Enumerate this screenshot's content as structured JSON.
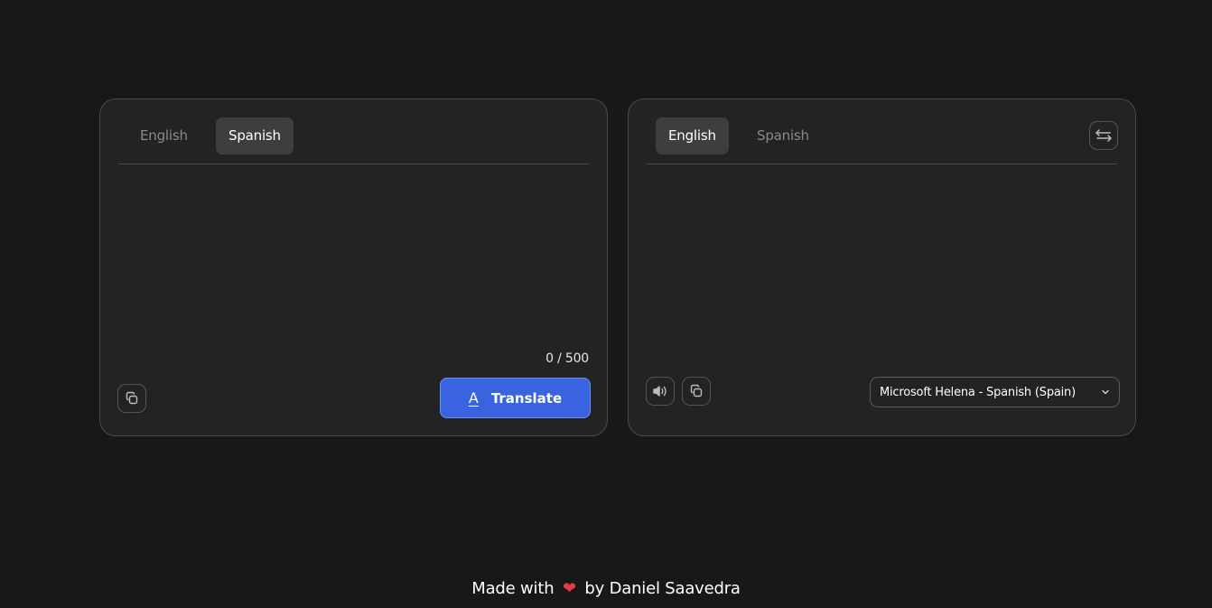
{
  "source_panel": {
    "tabs": [
      {
        "label": "English",
        "active": false
      },
      {
        "label": "Spanish",
        "active": true
      }
    ],
    "input_value": "",
    "char_counter": "0 / 500",
    "copy_icon": "copy-icon",
    "translate_button": {
      "label": "Translate",
      "icon": "A",
      "color": "#3a63e0"
    }
  },
  "target_panel": {
    "tabs": [
      {
        "label": "English",
        "active": true
      },
      {
        "label": "Spanish",
        "active": false
      }
    ],
    "swap_icon": "swap-icon",
    "output_value": "",
    "speaker_icon": "speaker-icon",
    "copy_icon": "copy-icon",
    "voice_select": {
      "selected": "Microsoft Helena - Spanish (Spain)"
    }
  },
  "footer": {
    "prefix": "Made with",
    "heart": "❤",
    "suffix": "by Daniel Saavedra"
  },
  "colors": {
    "background": "#181818",
    "panel": "#232323",
    "accent": "#3a63e0",
    "heart": "#e53a4a"
  }
}
